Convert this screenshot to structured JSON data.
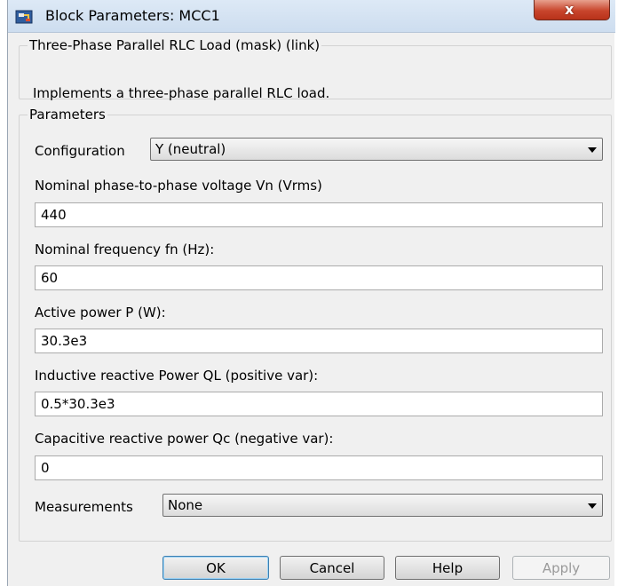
{
  "window": {
    "title": "Block Parameters: MCC1",
    "close_glyph": "x"
  },
  "mask": {
    "legend": "Three-Phase Parallel RLC Load (mask) (link)",
    "description": "Implements a three-phase parallel RLC load."
  },
  "parameters": {
    "legend": "Parameters",
    "configuration": {
      "label": "Configuration",
      "value": "Y (neutral)"
    },
    "voltage": {
      "label": "Nominal phase-to-phase voltage Vn (Vrms)",
      "value": "440"
    },
    "frequency": {
      "label": "Nominal frequency fn (Hz):",
      "value": "60"
    },
    "active_power": {
      "label": "Active power P (W):",
      "value": "30.3e3"
    },
    "inductive_power": {
      "label": "Inductive reactive Power QL (positive var):",
      "value": "0.5*30.3e3"
    },
    "capacitive_power": {
      "label": "Capacitive reactive power Qc (negative var):",
      "value": "0"
    },
    "measurements": {
      "label": "Measurements",
      "value": "None"
    }
  },
  "buttons": {
    "ok": "OK",
    "cancel": "Cancel",
    "help": "Help",
    "apply": "Apply"
  },
  "icons": {
    "app": "simulink-block-icon",
    "close": "close-icon",
    "dropdown": "chevron-down-icon"
  }
}
